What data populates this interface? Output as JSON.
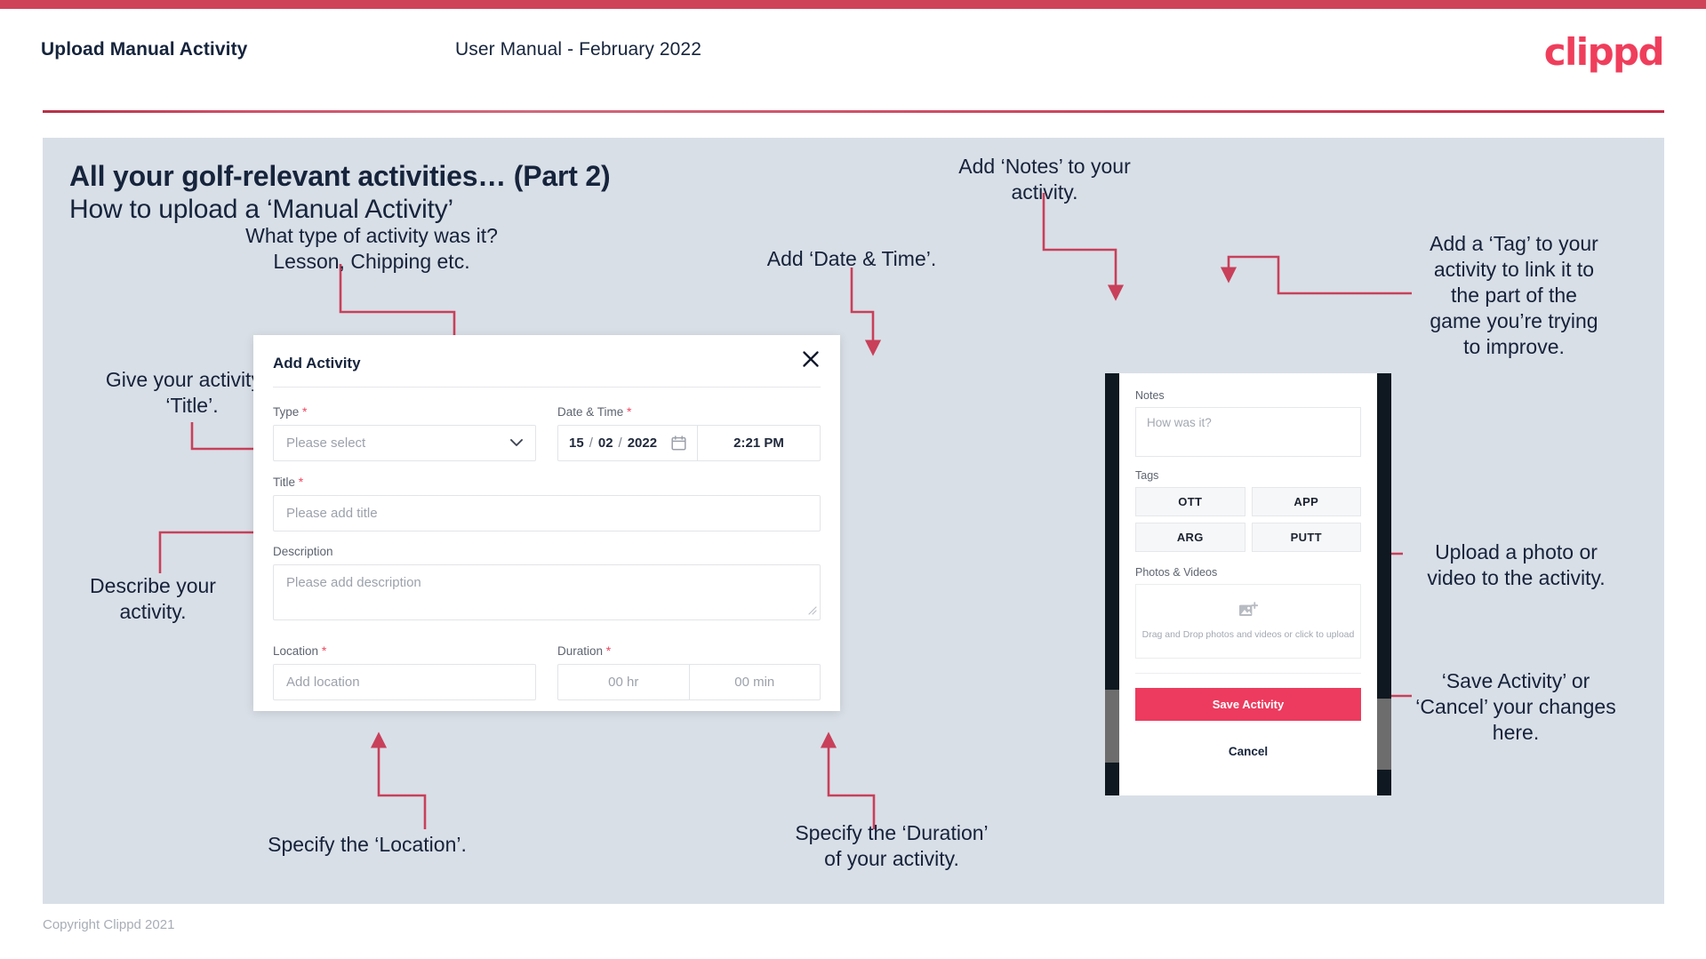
{
  "header": {
    "title": "Upload Manual Activity",
    "subtitle": "User Manual - February 2022",
    "logo": "clippd"
  },
  "slide": {
    "heading": "All your golf-relevant activities… (Part 2)",
    "subheading": "How to upload a ‘Manual Activity’"
  },
  "annotations": {
    "type": "What type of activity was it?\nLesson, Chipping etc.",
    "date_time": "Add ‘Date & Time’.",
    "title": "Give your activity a\n‘Title’.",
    "description": "Describe your\nactivity.",
    "location": "Specify the ‘Location’.",
    "duration": "Specify the ‘Duration’\nof your activity.",
    "notes": "Add ‘Notes’ to your\nactivity.",
    "tags": "Add a ‘Tag’ to your\nactivity to link it to\nthe part of the\ngame you’re trying\nto improve.",
    "upload": "Upload a photo or\nvideo to the activity.",
    "save_cancel": "‘Save Activity’ or\n‘Cancel’ your changes\nhere."
  },
  "dialog": {
    "title": "Add Activity",
    "close_icon": "close-icon",
    "fields": {
      "type": {
        "label": "Type",
        "required": "*",
        "placeholder": "Please select",
        "caret_icon": "chevron-down-icon"
      },
      "date_time": {
        "label": "Date & Time",
        "required": "*",
        "day": "15",
        "month": "02",
        "year": "2022",
        "sep": "/",
        "calendar_icon": "calendar-icon",
        "time": "2:21 PM"
      },
      "title": {
        "label": "Title",
        "required": "*",
        "placeholder": "Please add title"
      },
      "description": {
        "label": "Description",
        "required": "",
        "placeholder": "Please add description"
      },
      "location": {
        "label": "Location",
        "required": "*",
        "placeholder": "Add location"
      },
      "duration": {
        "label": "Duration",
        "required": "*",
        "hours_placeholder": "00 hr",
        "minutes_placeholder": "00 min"
      }
    }
  },
  "phone": {
    "notes_label": "Notes",
    "notes_placeholder": "How was it?",
    "tags_label": "Tags",
    "tags": [
      "OTT",
      "APP",
      "ARG",
      "PUTT"
    ],
    "photos_label": "Photos & Videos",
    "dropzone_icon": "image-add-icon",
    "dropzone_text": "Drag and Drop photos and videos or click to upload",
    "save_label": "Save Activity",
    "cancel_label": "Cancel"
  },
  "footer": {
    "copyright": "Copyright Clippd 2021"
  },
  "colors": {
    "accent": "#ec3b5e",
    "brand": "#ef3e5c",
    "connector": "#c8405a",
    "slide_bg": "#d9dfe7",
    "text_dark": "#16243c"
  }
}
